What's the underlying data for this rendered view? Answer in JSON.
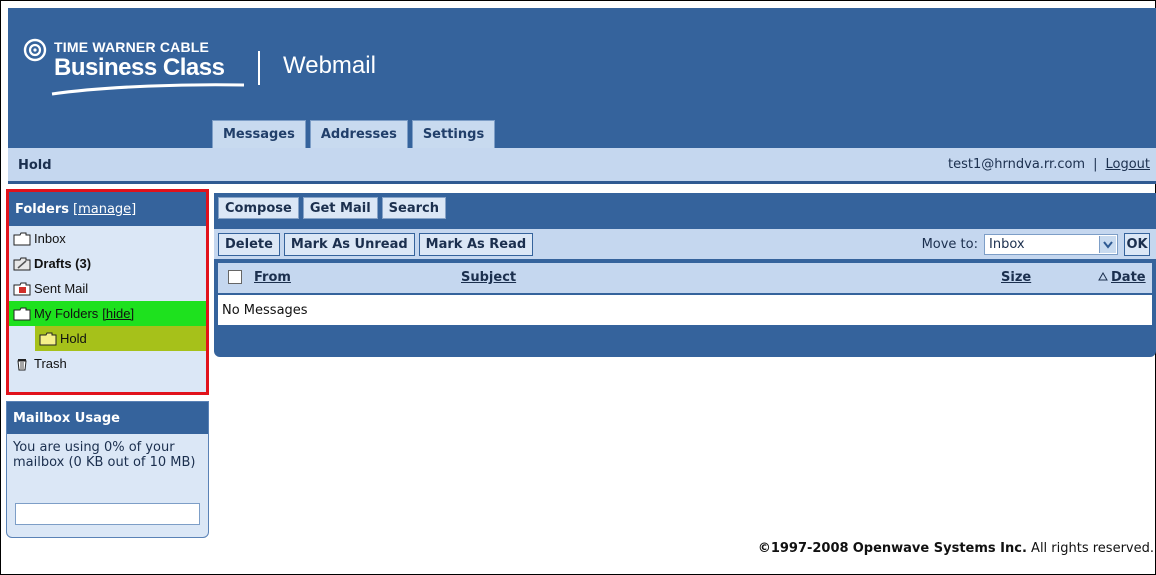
{
  "brand": {
    "top_line": "TIME WARNER CABLE",
    "main_line": "Business Class",
    "app_title": "Webmail",
    "color": "#35639c"
  },
  "tabs": [
    {
      "label": "Messages",
      "active": true
    },
    {
      "label": "Addresses",
      "active": false
    },
    {
      "label": "Settings",
      "active": false
    }
  ],
  "infobar": {
    "current_folder": "Hold",
    "user_email": "test1@hrndva.rr.com",
    "separator": "|",
    "logout_label": "Logout"
  },
  "folders": {
    "title": "Folders",
    "manage_label": "[manage]",
    "items": [
      {
        "label": "Inbox",
        "icon": "folder-icon"
      },
      {
        "label": "Drafts (3)",
        "icon": "drafts-icon"
      },
      {
        "label": "Sent Mail",
        "icon": "sent-mail-icon"
      },
      {
        "label": "My Folders",
        "hide_label": "[hide]",
        "icon": "folder-open-icon"
      },
      {
        "label": "Hold",
        "icon": "folder-icon"
      },
      {
        "label": "Trash",
        "icon": "trash-icon"
      }
    ],
    "highlight_my_folders": "#1ee11e",
    "highlight_hold": "#a6c11a"
  },
  "usage": {
    "title": "Mailbox Usage",
    "text": "You are using 0% of your mailbox (0 KB out of 10 MB)",
    "percent": 0
  },
  "toolbar": {
    "compose": "Compose",
    "get_mail": "Get Mail",
    "search": "Search",
    "delete": "Delete",
    "mark_unread": "Mark As Unread",
    "mark_read": "Mark As Read",
    "move_to_label": "Move to:",
    "move_to_value": "Inbox",
    "ok": "OK"
  },
  "columns": {
    "from": "From",
    "subject": "Subject",
    "size": "Size",
    "date": "Date",
    "date_sort_icon": "sort-up-icon"
  },
  "messages": {
    "empty_text": "No Messages"
  },
  "footer": {
    "copyright": "©1997-2008",
    "company": "Openwave Systems Inc.",
    "rights": "All rights reserved."
  }
}
